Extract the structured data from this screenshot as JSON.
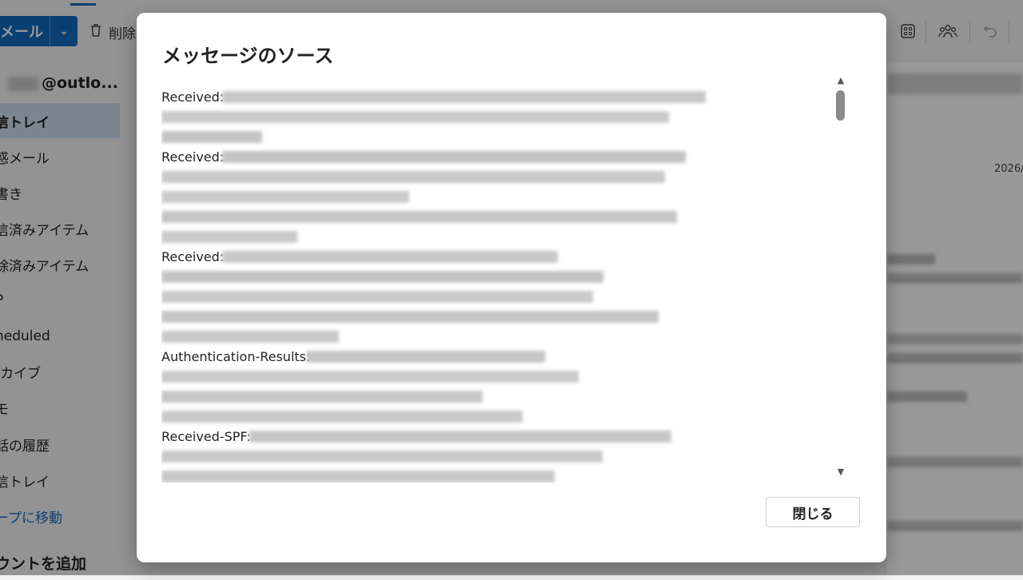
{
  "toolbar": {
    "new_mail_label": "メール",
    "delete_label": "削除"
  },
  "sidebar": {
    "account_suffix": "@outlo...",
    "folders": [
      {
        "label": "信トレイ"
      },
      {
        "label": "惑メール"
      },
      {
        "label": "書き"
      },
      {
        "label": "信済みアイテム"
      },
      {
        "label": "除済みアイテム"
      },
      {
        "label": "P"
      },
      {
        "label": "heduled"
      },
      {
        "label": "-カイブ"
      },
      {
        "label": "モ"
      },
      {
        "label": "話の履歴"
      },
      {
        "label": "信トレイ"
      },
      {
        "label": "ープに移動"
      },
      {
        "label": "ウントを追加"
      }
    ]
  },
  "reading_pane": {
    "date_partial": "2026/"
  },
  "dialog": {
    "title": "メッセージのソース",
    "headers": [
      {
        "name": "Received:"
      },
      {
        "name": "Received:"
      },
      {
        "name": "Received:"
      },
      {
        "name": "Authentication-Results:"
      },
      {
        "name": "Received-SPF:"
      }
    ],
    "close_label": "閉じる"
  },
  "icons": {
    "delete": "trash-icon",
    "apps": "grid-icon",
    "people": "people-icon",
    "undo": "undo-icon",
    "dropdown": "chevron-down-icon",
    "scroll_up": "triangle-up-icon",
    "scroll_down": "triangle-down-icon"
  },
  "colors": {
    "accent": "#0f6cbd",
    "selected_folder": "#cfe0f1",
    "overlay": "rgba(0,0,0,0.40)"
  }
}
